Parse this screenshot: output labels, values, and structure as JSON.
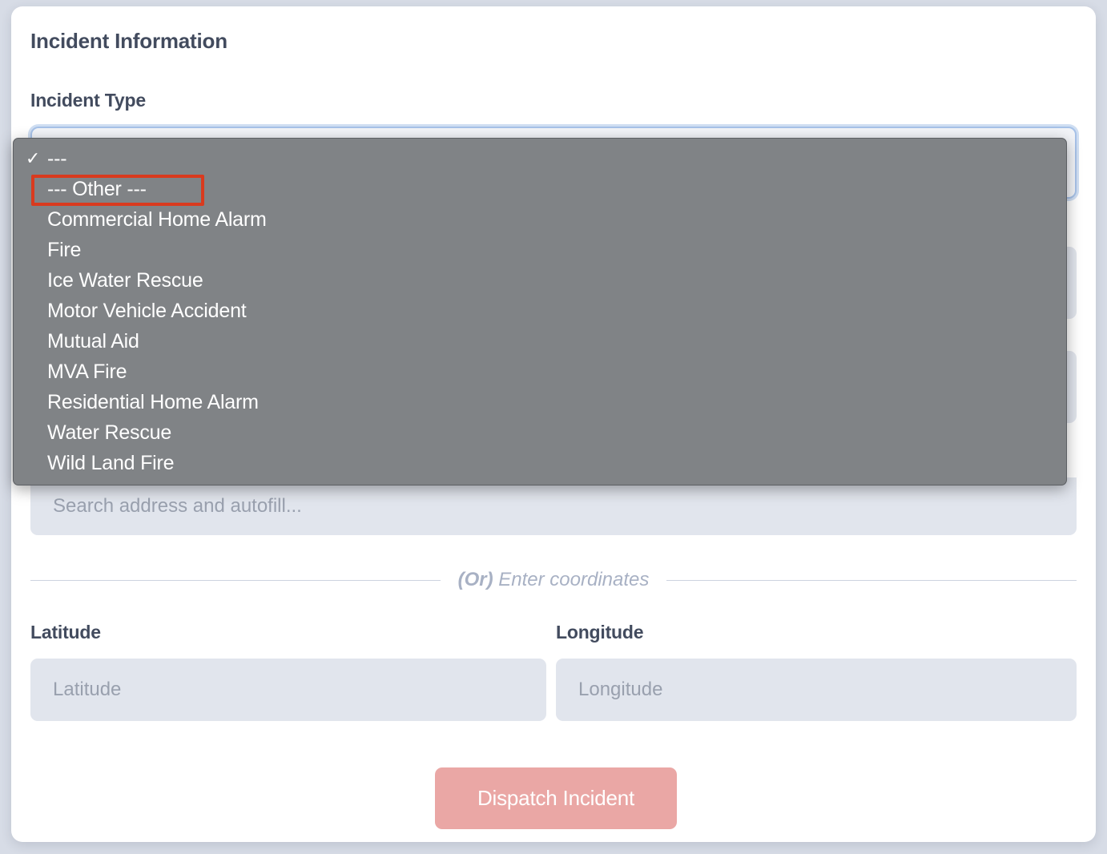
{
  "card": {
    "section_title": "Incident Information"
  },
  "form": {
    "incident_type": {
      "label": "Incident Type",
      "selected_value": ""
    },
    "address_search": {
      "placeholder": "Search address and autofill..."
    },
    "divider": {
      "or": "(Or)",
      "text": " Enter coordinates"
    },
    "latitude": {
      "label": "Latitude",
      "placeholder": "Latitude",
      "value": ""
    },
    "longitude": {
      "label": "Longitude",
      "placeholder": "Longitude",
      "value": ""
    },
    "submit": {
      "label": "Dispatch Incident"
    }
  },
  "dropdown": {
    "selected_index": 0,
    "highlighted_index": 1,
    "check_glyph": "✓",
    "options": [
      {
        "label": "---"
      },
      {
        "label": "--- Other ---"
      },
      {
        "label": "Commercial Home Alarm"
      },
      {
        "label": "Fire"
      },
      {
        "label": "Ice Water Rescue"
      },
      {
        "label": "Motor Vehicle Accident"
      },
      {
        "label": "Mutual Aid"
      },
      {
        "label": "MVA Fire"
      },
      {
        "label": "Residential Home Alarm"
      },
      {
        "label": "Water Rescue"
      },
      {
        "label": "Wild Land Fire"
      }
    ]
  },
  "colors": {
    "page_background": "#d7dce6",
    "card_background": "#ffffff",
    "text_dark": "#424b5e",
    "input_background": "#e1e5ed",
    "placeholder": "#99a0ae",
    "focus_ring": "#a7c2e8",
    "dropdown_background": "#808386",
    "dropdown_text": "#ffffff",
    "highlight_border": "#d93a1e",
    "button_background": "#eaa7a5",
    "button_text": "#ffffff",
    "divider_rule": "#ccd3e0",
    "divider_text": "#a8b1c4"
  }
}
